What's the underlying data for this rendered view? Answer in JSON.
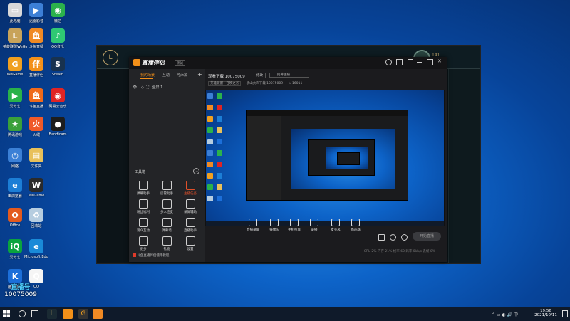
{
  "desktop_icons": [
    {
      "label": "此电脑",
      "color": "#d9d9d9",
      "glyph": "▭"
    },
    {
      "label": "迅雷影音",
      "color": "#3c7fd6",
      "glyph": "▶"
    },
    {
      "label": "微信",
      "color": "#2bb24c",
      "glyph": "◉"
    },
    {
      "label": "英雄联盟WeGame版",
      "color": "#c8a35a",
      "glyph": "L"
    },
    {
      "label": "斗鱼直播",
      "color": "#f08a24",
      "glyph": "鱼"
    },
    {
      "label": "QQ音乐",
      "color": "#2fc873",
      "glyph": "♪"
    },
    {
      "label": "WeGame",
      "color": "#f0a020",
      "glyph": "G"
    },
    {
      "label": "直播伴侣",
      "color": "#f39019",
      "glyph": "伴"
    },
    {
      "label": "Steam",
      "color": "#18324f",
      "glyph": "S"
    },
    {
      "label": "爱奇艺",
      "color": "#2ab24a",
      "glyph": "▶"
    },
    {
      "label": "斗鱼直播",
      "color": "#f06a1a",
      "glyph": "鱼"
    },
    {
      "label": "网易云音乐",
      "color": "#e02424",
      "glyph": "◉"
    },
    {
      "label": "腾讯游戏",
      "color": "#3aa03a",
      "glyph": "★"
    },
    {
      "label": "火绒",
      "color": "#f05a28",
      "glyph": "火"
    },
    {
      "label": "Bandicam",
      "color": "#1d1d1d",
      "glyph": "●"
    },
    {
      "label": "网络",
      "color": "#3b80d6",
      "glyph": "◎"
    },
    {
      "label": "文件夹",
      "color": "#e8c05a",
      "glyph": "▤"
    },
    {
      "label": "IE浏览器",
      "color": "#1c7ed6",
      "glyph": "e"
    },
    {
      "label": "WeGame",
      "color": "#2a2a2a",
      "glyph": "W"
    },
    {
      "label": "Office",
      "color": "#e35a1e",
      "glyph": "O"
    },
    {
      "label": "回收站",
      "color": "#b6cde0",
      "glyph": "♻"
    },
    {
      "label": "爱奇艺",
      "color": "#0aa33e",
      "glyph": "iQ"
    },
    {
      "label": "Microsoft Edge",
      "color": "#1a8ad8",
      "glyph": "e"
    },
    {
      "label": "酷狗音乐",
      "color": "#1c6fd9",
      "glyph": "K"
    },
    {
      "label": "QQ",
      "color": "#f5f5f5",
      "glyph": "Q"
    }
  ],
  "app": {
    "logo_text": "直播伴侣",
    "badge": "测试",
    "tabs": [
      "我的场景",
      "互动",
      "可添加"
    ],
    "scene_item": "全屏 1",
    "tools_header": "工具箱",
    "tools": [
      {
        "label": "弹幕助手"
      },
      {
        "label": "房管助手"
      },
      {
        "label": "主播任务"
      },
      {
        "label": "粉丝福利"
      },
      {
        "label": "多人连麦"
      },
      {
        "label": "录屏辅助"
      },
      {
        "label": "观众互动"
      },
      {
        "label": "弹幕墙"
      },
      {
        "label": "直播助手"
      },
      {
        "label": "更多"
      },
      {
        "label": "礼物"
      },
      {
        "label": "设置"
      }
    ],
    "tip_text": "斗鱼直播伴侣使用教程",
    "room_line": "观看下载 10075009",
    "room_tag": "修改",
    "room_input": "招募主播",
    "meta": [
      "英雄联盟 · 召唤之谷",
      "骄山大声下载 10075009",
      "16011"
    ],
    "bottom_buttons": [
      "直播录屏",
      "摄像头",
      "手机投屏",
      "录播",
      "麦克风",
      "扬声器"
    ],
    "start_button": "开始直播",
    "status_bar": "CPU 2%  内存 21%  帧率 60  码率 0kb/s  丢帧 0%"
  },
  "watermark": {
    "line1": "直播号",
    "line2": "10075009"
  },
  "taskbar": {
    "time": "19:56",
    "date": "2021/10/11"
  },
  "accents": {
    "orange": "#f39019",
    "lol_gold": "#c8aa6e"
  }
}
